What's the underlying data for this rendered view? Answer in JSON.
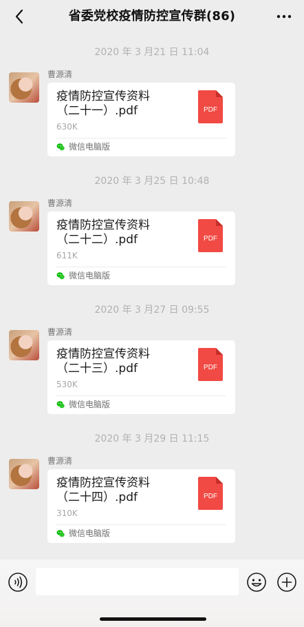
{
  "header": {
    "title": "省委党校疫情防控宣传群(86)",
    "back_icon": "chevron-left-icon",
    "more_icon": "more-dots-icon"
  },
  "messages": [
    {
      "timestamp": "2020 年 3 月21 日 11:04",
      "sender": "曹源清",
      "file_line1": "疫情防控宣传资料",
      "file_line2": "（二十一）.pdf",
      "file_size": "630K",
      "source": "微信电脑版"
    },
    {
      "timestamp": "2020 年 3 月25 日 10:48",
      "sender": "曹源清",
      "file_line1": "疫情防控宣传资料",
      "file_line2": "（二十二）.pdf",
      "file_size": "611K",
      "source": "微信电脑版"
    },
    {
      "timestamp": "2020 年 3 月27 日 09:55",
      "sender": "曹源清",
      "file_line1": "疫情防控宣传资料",
      "file_line2": "（二十三）.pdf",
      "file_size": "530K",
      "source": "微信电脑版"
    },
    {
      "timestamp": "2020 年 3 月29 日 11:15",
      "sender": "曹源清",
      "file_line1": "疫情防控宣传资料",
      "file_line2": "（二十四）.pdf",
      "file_size": "310K",
      "source": "微信电脑版"
    }
  ],
  "pdf_badge": "PDF",
  "colors": {
    "pdf_red": "#f14a44",
    "wechat_green": "#09bb07",
    "background": "#ededed"
  }
}
